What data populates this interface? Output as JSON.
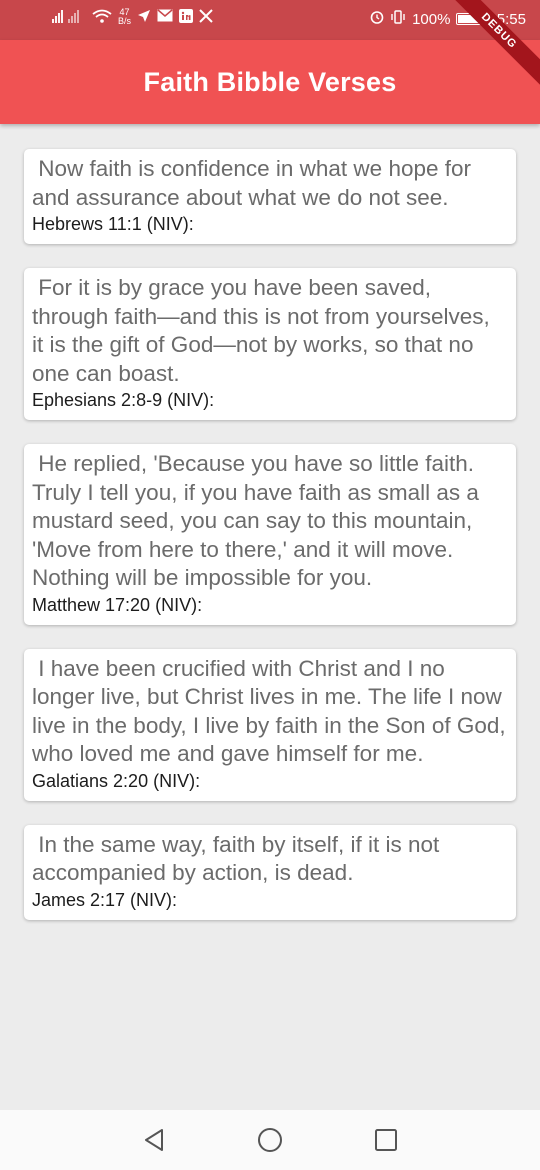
{
  "status_bar": {
    "net_speed_value": "47",
    "net_speed_unit": "B/s",
    "battery_text": "100%",
    "time": "15:55"
  },
  "debug_banner": "DEBUG",
  "app_bar": {
    "title": "Faith Bibble Verses"
  },
  "verses": [
    {
      "text": " Now faith is confidence in what we hope for and assurance about what we do not see.",
      "reference": "Hebrews 11:1 (NIV):"
    },
    {
      "text": " For it is by grace you have been saved, through faith—and this is not from yourselves, it is the gift of God—not by works, so that no one can boast.",
      "reference": "Ephesians 2:8-9 (NIV):"
    },
    {
      "text": " He replied, 'Because you have so little faith. Truly I tell you, if you have faith as small as a mustard seed, you can say to this mountain, 'Move from here to there,' and it will move. Nothing will be impossible for you.",
      "reference": "Matthew 17:20 (NIV):"
    },
    {
      "text": " I have been crucified with Christ and I no longer live, but Christ lives in me. The life I now live in the body, I live by faith in the Son of God, who loved me and gave himself for me.",
      "reference": "Galatians 2:20 (NIV):"
    },
    {
      "text": " In the same way, faith by itself, if it is not accompanied by action, is dead.",
      "reference": "James 2:17 (NIV):"
    }
  ],
  "nav": {
    "back": "back-icon",
    "home": "home-icon",
    "recents": "recents-icon"
  }
}
